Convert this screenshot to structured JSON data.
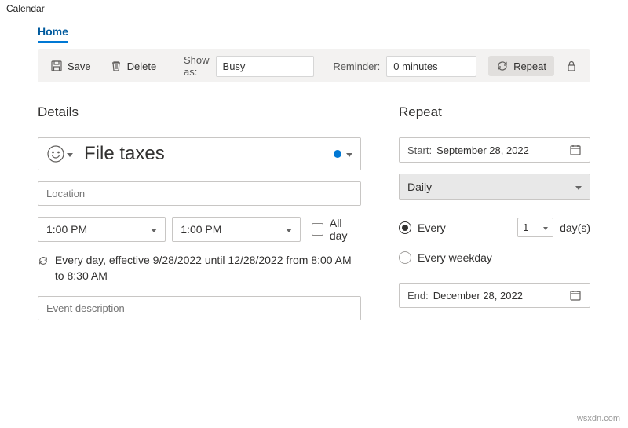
{
  "app_title": "Calendar",
  "tabs": {
    "home": "Home"
  },
  "toolbar": {
    "save": "Save",
    "delete": "Delete",
    "showas_label": "Show as:",
    "showas_value": "Busy",
    "reminder_label": "Reminder:",
    "reminder_value": "0 minutes",
    "repeat": "Repeat"
  },
  "details": {
    "heading": "Details",
    "title_value": "File taxes",
    "location_placeholder": "Location",
    "start_time": "1:00 PM",
    "end_time": "1:00 PM",
    "all_day": "All day",
    "recurrence_text": "Every day, effective 9/28/2022 until 12/28/2022 from 8:00 AM to 8:30 AM",
    "description_placeholder": "Event description"
  },
  "repeat": {
    "heading": "Repeat",
    "start_label": "Start:",
    "start_value": "September 28, 2022",
    "frequency": "Daily",
    "every_label": "Every",
    "every_value": "1",
    "every_unit": "day(s)",
    "weekday_label": "Every weekday",
    "end_label": "End:",
    "end_value": "December 28, 2022"
  },
  "footer": "wsxdn.com"
}
